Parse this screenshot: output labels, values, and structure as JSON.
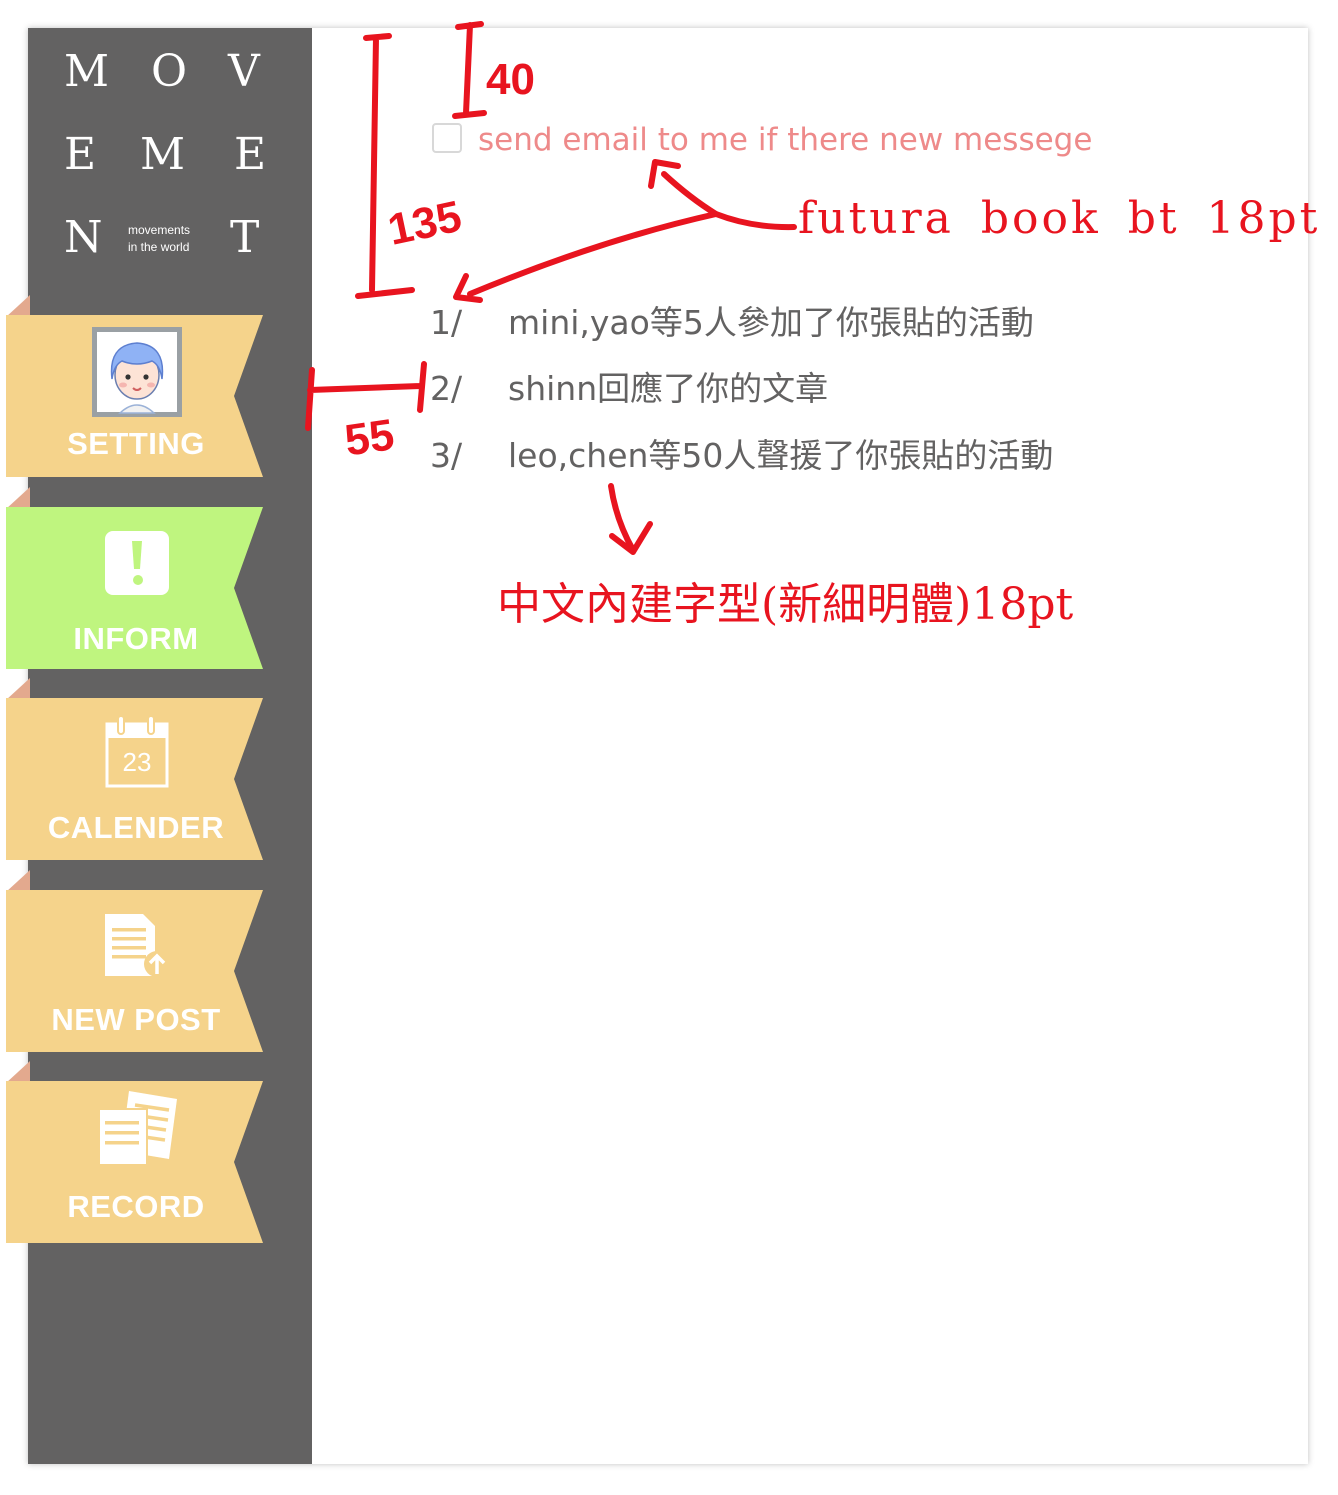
{
  "logo": {
    "letters": [
      "M",
      "O",
      "V",
      "E",
      "M",
      "E",
      "N",
      "T"
    ],
    "tagline_line1": "movements",
    "tagline_line2": "in the world"
  },
  "nav": [
    {
      "label": "SETTING",
      "icon": "avatar-photo",
      "active": false,
      "color": "#f5d38b"
    },
    {
      "label": "INFORM",
      "icon": "exclamation-icon",
      "active": true,
      "color": "#bff57f"
    },
    {
      "label": "CALENDER",
      "icon": "calendar-icon",
      "active": false,
      "color": "#f5d38b",
      "calendar_day": "23"
    },
    {
      "label": "NEW POST",
      "icon": "new-post-icon",
      "active": false,
      "color": "#f5d38b"
    },
    {
      "label": "RECORD",
      "icon": "record-icon",
      "active": false,
      "color": "#f5d38b"
    }
  ],
  "email_option": {
    "label": "send email to me if there new messege",
    "checked": false
  },
  "notifications": [
    {
      "number": "1/",
      "text": "mini,yao等5人參加了你張貼的活動"
    },
    {
      "number": "2/",
      "text": "shinn回應了你的文章"
    },
    {
      "number": "3/",
      "text": "leo,chen等50人聲援了你張貼的活動"
    }
  ],
  "annotations": {
    "spacing_top": "40",
    "spacing_list": "135",
    "spacing_indent": "55",
    "font_note_en": "futura book bt 18pt",
    "font_note_zh": "中文內建字型(新細明體)18pt"
  },
  "colors": {
    "sidebar": "#636262",
    "ribbon": "#f5d38b",
    "ribbon_active": "#bff57f",
    "annotation": "#e8141f",
    "email_label": "#ee8a8a",
    "list_text": "#636262"
  }
}
